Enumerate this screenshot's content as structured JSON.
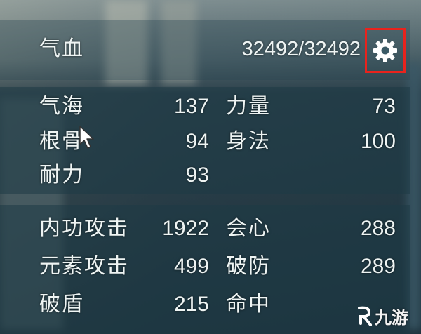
{
  "hp": {
    "label": "气血",
    "value": "32492/32492"
  },
  "settings_icon": "gear-icon",
  "base_stats": [
    {
      "label": "气海",
      "value": "137"
    },
    {
      "label": "力量",
      "value": "73"
    },
    {
      "label": "根骨",
      "value": "94"
    },
    {
      "label": "身法",
      "value": "100"
    },
    {
      "label": "耐力",
      "value": "93"
    }
  ],
  "combat_stats": [
    {
      "label": "内功攻击",
      "value": "1922"
    },
    {
      "label": "会心",
      "value": "288"
    },
    {
      "label": "元素攻击",
      "value": "499"
    },
    {
      "label": "破防",
      "value": "289"
    },
    {
      "label": "破盾",
      "value": "215"
    },
    {
      "label": "命中",
      "value": ""
    }
  ],
  "watermark": {
    "text": "九游",
    "icon": "jiuyou-logo-icon"
  },
  "colors": {
    "highlight_border": "#e8231d",
    "text": "#eef4f3"
  }
}
